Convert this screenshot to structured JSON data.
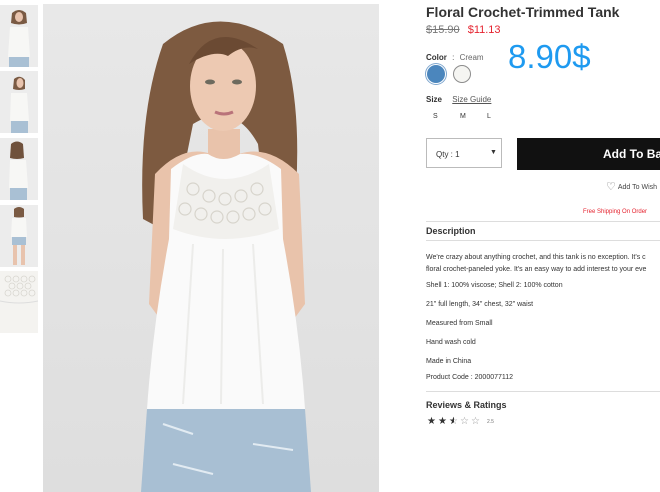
{
  "product": {
    "title": "Floral Crochet-Trimmed Tank",
    "old_price": "$15.90",
    "new_price": "$11.13",
    "overlay_price": "8.90$"
  },
  "color": {
    "label": "Color",
    "separator": ":",
    "value": "Cream",
    "swatches": [
      {
        "name": "blue",
        "hex": "#4b86bd"
      },
      {
        "name": "cream",
        "hex": "#f5f5f2"
      }
    ]
  },
  "size": {
    "label": "Size",
    "guide_label": "Size Guide",
    "options": [
      "S",
      "M",
      "L"
    ]
  },
  "qty": {
    "label": "Qty : 1",
    "caret_icon": "caret-down-icon"
  },
  "cart": {
    "add_label": "Add To Bag"
  },
  "wishlist": {
    "label": "Add To Wish",
    "icon": "heart-icon"
  },
  "shipping": {
    "notice": "Free Shipping On Order"
  },
  "description": {
    "heading": "Description",
    "lines": [
      "We're crazy about anything crochet, and this tank is no exception. It's c",
      "floral crochet-paneled yoke. It's an easy way to add interest to your eve",
      "Shell 1: 100% viscose; Shell 2: 100% cotton",
      "21\" full length, 34\" chest, 32\" waist",
      "Measured from Small",
      "Hand wash cold",
      "Made in China",
      "Product Code : 2000077112"
    ]
  },
  "reviews": {
    "heading": "Reviews & Ratings",
    "rating": 2.5,
    "max_rating": 5,
    "rating_text": "2.5"
  },
  "colors": {
    "accent_price": "#1e9af0",
    "sale_red": "#e5232f",
    "button_bg": "#111111"
  }
}
